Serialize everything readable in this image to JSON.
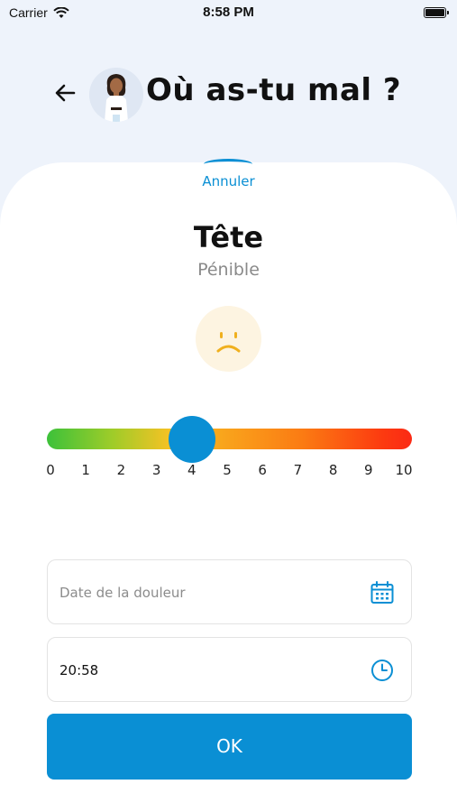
{
  "status_bar": {
    "carrier": "Carrier",
    "time": "8:58 PM"
  },
  "header": {
    "title": "Où as-tu mal ?"
  },
  "sheet": {
    "cancel_label": "Annuler",
    "body_part": "Tête",
    "pain_label": "Pénible",
    "slider": {
      "value": 4,
      "min": 0,
      "max": 10,
      "ticks": [
        "0",
        "1",
        "2",
        "3",
        "4",
        "5",
        "6",
        "7",
        "8",
        "9",
        "10"
      ]
    },
    "date_field": {
      "placeholder": "Date de la douleur",
      "value": ""
    },
    "time_field": {
      "value": "20:58"
    },
    "ok_label": "OK"
  },
  "colors": {
    "accent": "#0a8fd4",
    "background": "#eef3fb"
  }
}
